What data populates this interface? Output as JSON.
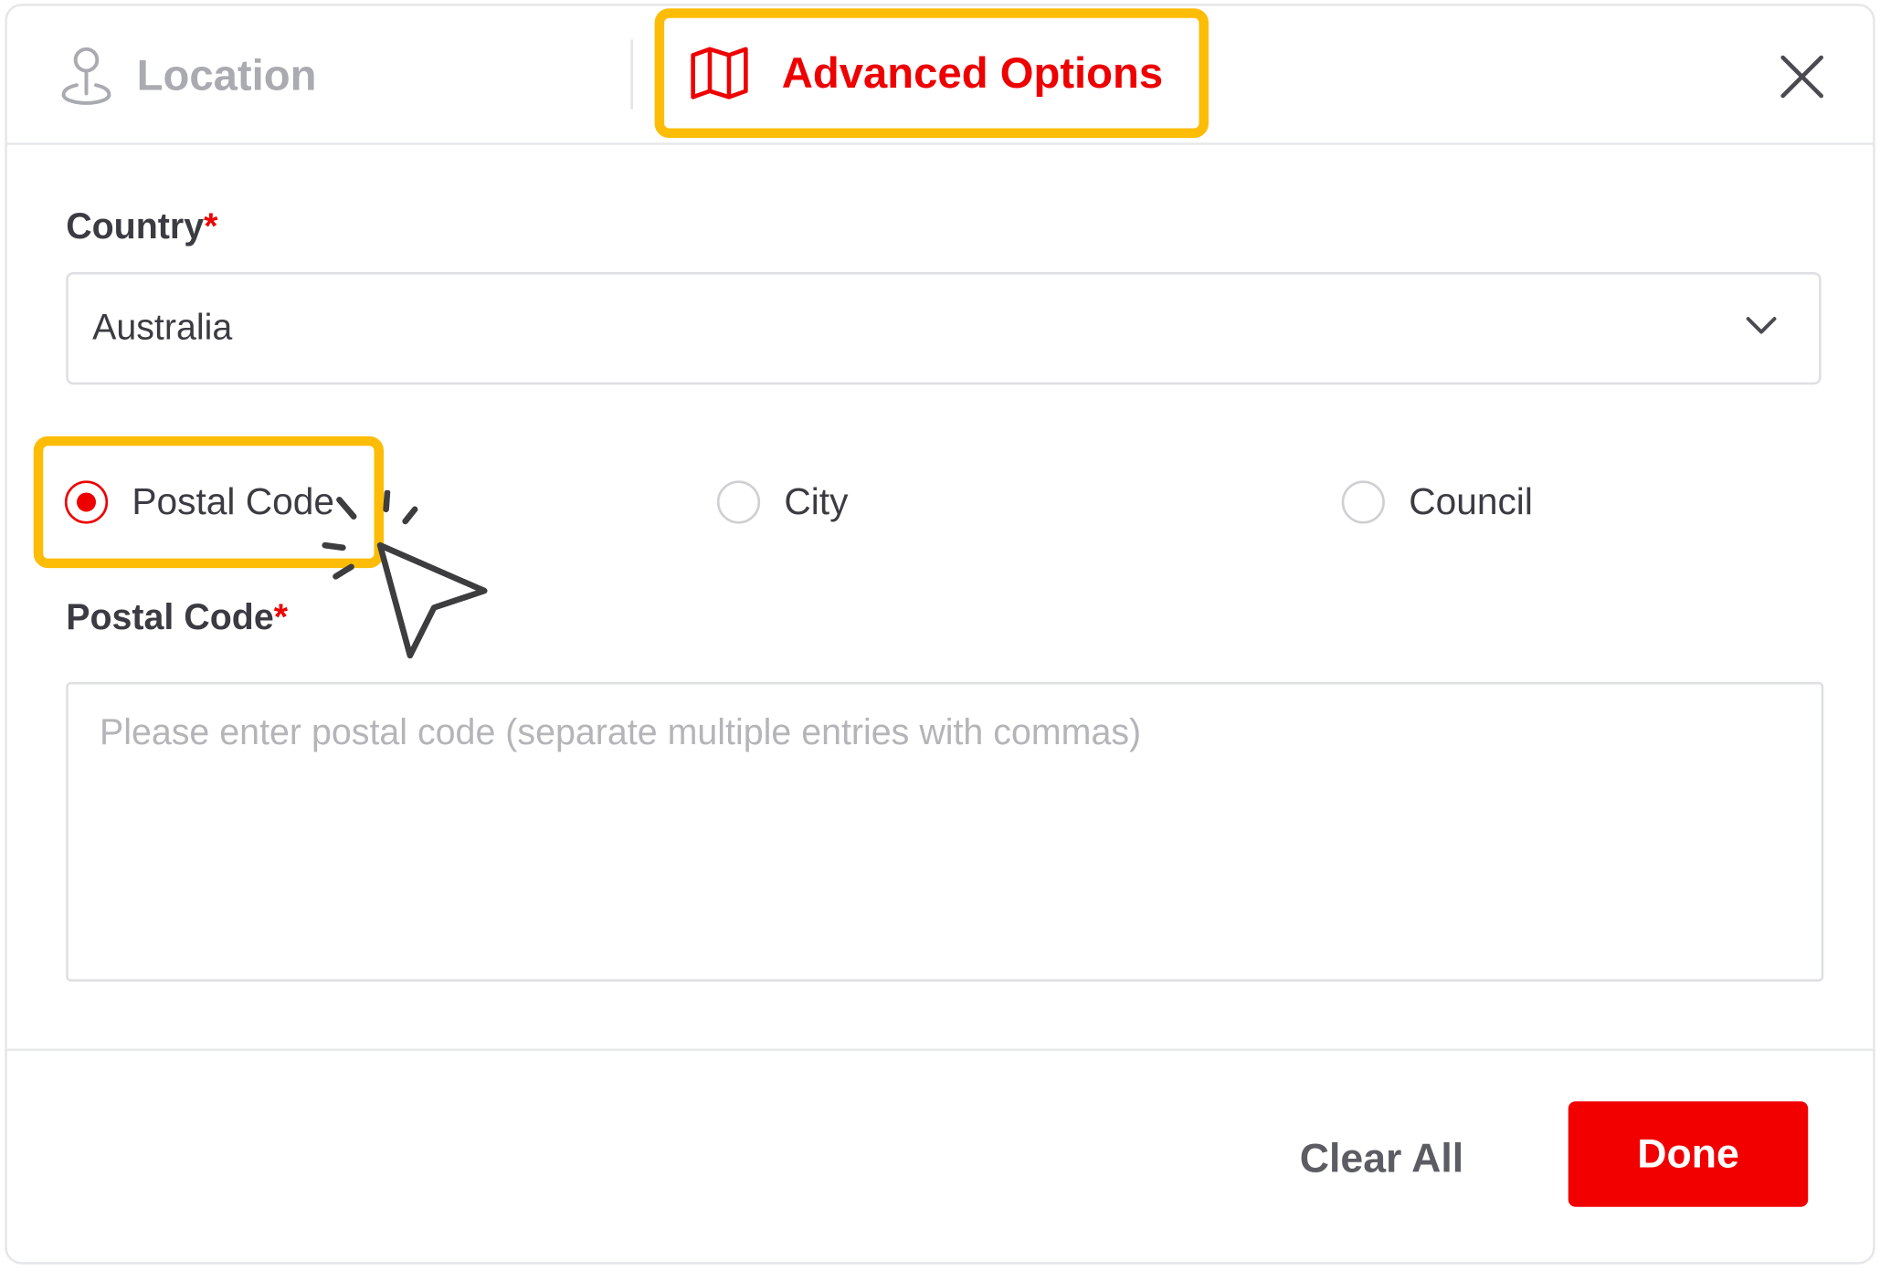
{
  "tabs": {
    "location_label": "Location",
    "advanced_label": "Advanced Options",
    "active": "advanced"
  },
  "form": {
    "country": {
      "label": "Country",
      "required_mark": "*",
      "selected_value": "Australia"
    },
    "search_type": {
      "options": [
        "Postal Code",
        "City",
        "Council"
      ],
      "selected": "Postal Code"
    },
    "postal_code": {
      "label": "Postal Code",
      "required_mark": "*",
      "value": "",
      "placeholder": "Please enter postal code (separate multiple entries with commas)"
    }
  },
  "footer": {
    "clear_label": "Clear All",
    "done_label": "Done"
  },
  "colors": {
    "accent": "#ee0000",
    "highlight": "#fdbc06",
    "text": "#3b3c42",
    "muted": "#a9abb0",
    "border": "#dfe0e3"
  },
  "icons": {
    "location_tab": "map-pin-icon",
    "advanced_tab": "map-icon",
    "close": "close-icon",
    "dropdown": "chevron-down-icon",
    "pointer": "cursor-click-icon"
  }
}
